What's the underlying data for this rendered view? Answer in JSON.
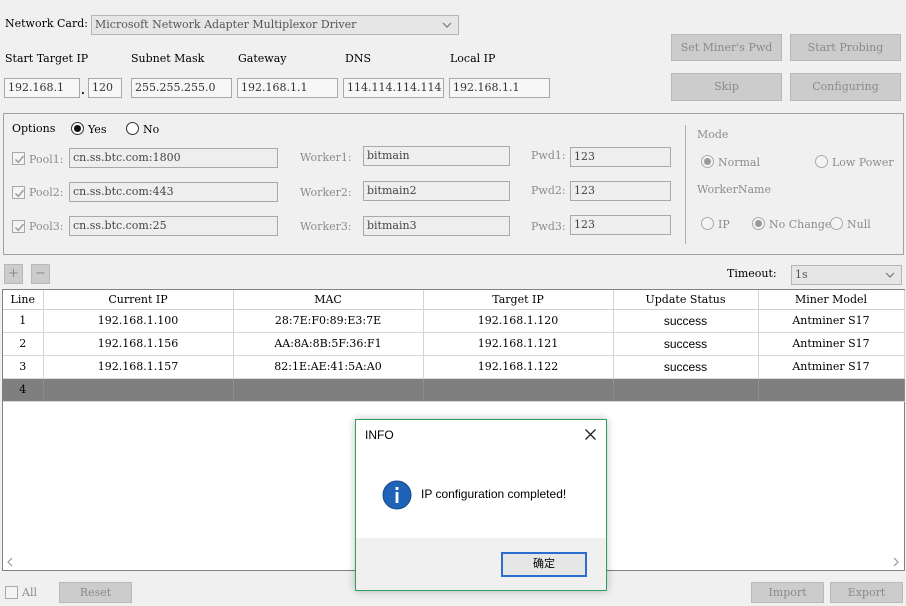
{
  "network": {
    "label": "Network Card:",
    "value": "Microsoft Network Adapter Multiplexor Driver"
  },
  "ipconfig": {
    "start_target_ip_label": "Start Target IP",
    "start_ip_value": "192.168.1",
    "dot": ".",
    "start_ip_last": "120",
    "subnet_label": "Subnet Mask",
    "subnet_value": "255.255.255.0",
    "gateway_label": "Gateway",
    "gateway_value": "192.168.1.1",
    "dns_label": "DNS",
    "dns_value": "114.114.114.114",
    "local_ip_label": "Local IP",
    "local_ip_value": "192.168.1.1"
  },
  "actions": {
    "set_pwd": "Set Miner's Pwd",
    "start_probing": "Start Probing",
    "skip": "Skip",
    "configuring": "Configuring"
  },
  "options": {
    "label": "Options",
    "yes": "Yes",
    "no": "No",
    "pools": [
      {
        "label": "Pool1:",
        "value": "cn.ss.btc.com:1800",
        "worker_label": "Worker1:",
        "worker": "bitmain",
        "pwd_label": "Pwd1:",
        "pwd": "123"
      },
      {
        "label": "Pool2:",
        "value": "cn.ss.btc.com:443",
        "worker_label": "Worker2:",
        "worker": "bitmain2",
        "pwd_label": "Pwd2:",
        "pwd": "123"
      },
      {
        "label": "Pool3:",
        "value": "cn.ss.btc.com:25",
        "worker_label": "Worker3:",
        "worker": "bitmain3",
        "pwd_label": "Pwd3:",
        "pwd": "123"
      }
    ]
  },
  "mode": {
    "label": "Mode",
    "normal": "Normal",
    "low_power": "Low Power",
    "worker_name_label": "WorkerName",
    "ip": "IP",
    "no_change": "No Change",
    "null": "Null"
  },
  "toolbar": {
    "add": "+",
    "remove": "−",
    "timeout_label": "Timeout:",
    "timeout_value": "1s"
  },
  "table": {
    "headers": [
      "Line",
      "Current IP",
      "MAC",
      "Target IP",
      "Update Status",
      "Miner Model"
    ],
    "rows": [
      [
        "1",
        "192.168.1.100",
        "28:7E:F0:89:E3:7E",
        "192.168.1.120",
        "success",
        "Antminer S17"
      ],
      [
        "2",
        "192.168.1.156",
        "AA:8A:8B:5F:36:F1",
        "192.168.1.121",
        "success",
        "Antminer S17"
      ],
      [
        "3",
        "192.168.1.157",
        "82:1E:AE:41:5A:A0",
        "192.168.1.122",
        "success",
        "Antminer S17"
      ],
      [
        "4",
        "",
        "",
        "",
        "",
        ""
      ]
    ]
  },
  "footer": {
    "all": "All",
    "reset": "Reset",
    "import": "Import",
    "export": "Export"
  },
  "dialog": {
    "title": "INFO",
    "message": "IP configuration completed!",
    "ok": "确定"
  },
  "colors": {
    "accent": "#2a6fcf",
    "dialog_border": "#2e9e5a",
    "selected_row": "#7f7f7f"
  }
}
